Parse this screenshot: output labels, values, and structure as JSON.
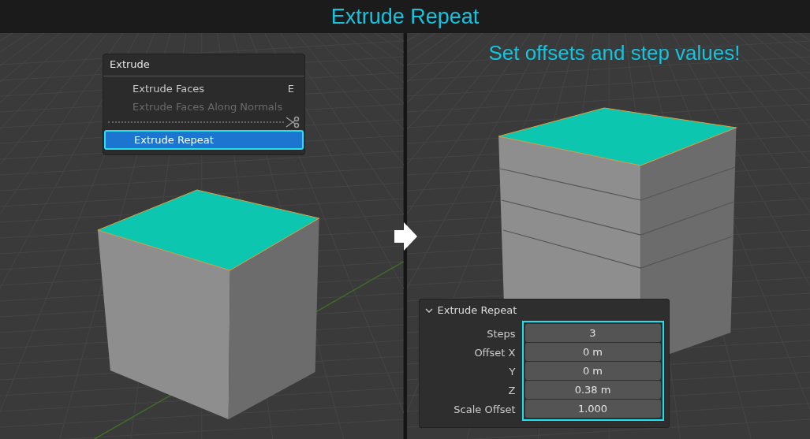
{
  "title": "Extrude Repeat",
  "left_viewport": {
    "menu": {
      "title": "Extrude",
      "items": [
        {
          "kind": "item",
          "label": "Extrude Faces",
          "shortcut": "E",
          "disabled": false,
          "selected": false
        },
        {
          "kind": "item",
          "label": "Extrude Faces Along Normals",
          "disabled": true,
          "selected": false
        },
        {
          "kind": "tear_off"
        },
        {
          "kind": "item",
          "label": "Extrude Repeat",
          "disabled": false,
          "selected": true
        }
      ]
    }
  },
  "right_viewport": {
    "caption": "Set offsets and step values!",
    "panel": {
      "title": "Extrude Repeat",
      "expanded": true,
      "highlighted": true,
      "fields": [
        {
          "label": "Steps",
          "value": "3"
        },
        {
          "label": "Offset X",
          "value": "0 m"
        },
        {
          "label": "Y",
          "value": "0 m"
        },
        {
          "label": "Z",
          "value": "0.38 m"
        },
        {
          "label": "Scale Offset",
          "value": "1.000"
        }
      ]
    }
  }
}
